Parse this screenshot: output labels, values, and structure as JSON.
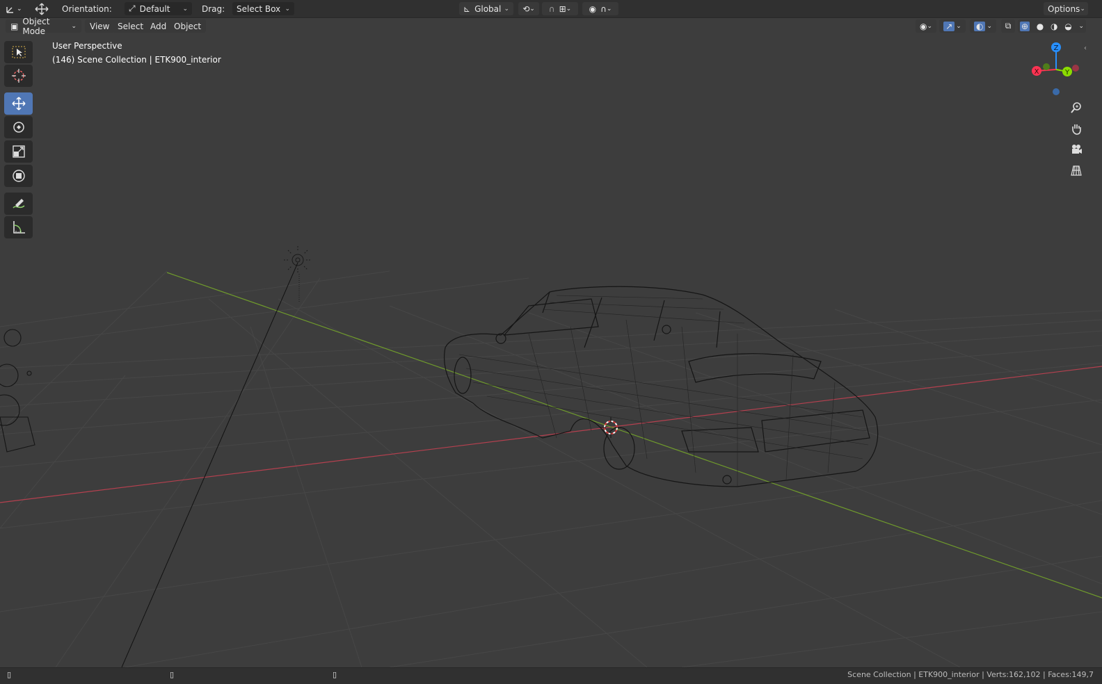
{
  "topbar": {
    "orientation_label": "Orientation:",
    "orientation_value": "Default",
    "drag_label": "Drag:",
    "drag_value": "Select Box",
    "transform_space": "Global",
    "options_label": "Options"
  },
  "header": {
    "mode": "Object Mode",
    "menus": [
      "View",
      "Select",
      "Add",
      "Object"
    ]
  },
  "overlay": {
    "view_name": "User Perspective",
    "collection_info": "(146) Scene Collection | ETK900_interior"
  },
  "gizmo": {
    "axes": [
      "Z",
      "X",
      "Y"
    ],
    "colors": {
      "x": "#ff3352",
      "y": "#8bdc00",
      "z": "#2890ff"
    }
  },
  "tools": [
    "select-box",
    "cursor",
    "move",
    "rotate",
    "scale",
    "transform",
    "annotate",
    "measure"
  ],
  "active_tool": "move",
  "statusbar": {
    "info": "Scene Collection | ETK900_interior | Verts:162,102 | Faces:149,7"
  },
  "colors": {
    "background": "#3d3d3d",
    "header": "#303030",
    "active_tool": "#5077b5",
    "grid_x_axis": "#b5404f",
    "grid_y_axis": "#6f9a2c"
  }
}
